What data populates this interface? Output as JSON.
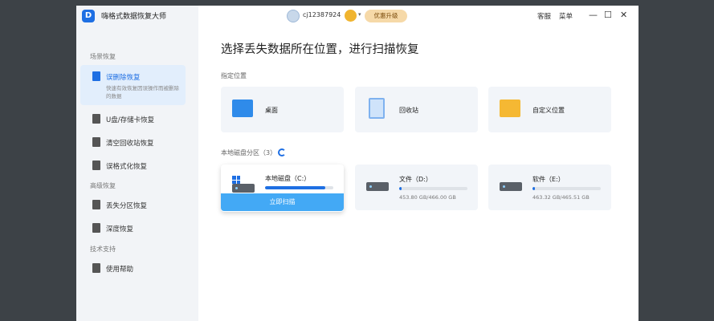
{
  "app": {
    "logo_letter": "D",
    "title": "嗨格式数据恢复大师"
  },
  "header": {
    "username": "cj12387924",
    "upgrade_label": "优惠升级",
    "service_label": "客服",
    "menu_label": "菜单",
    "minimize": "—",
    "maximize": "☐",
    "close": "✕"
  },
  "sidebar": {
    "groups": [
      {
        "label": "场景恢复"
      },
      {
        "label": "高级恢复"
      },
      {
        "label": "技术支持"
      }
    ],
    "active_item": {
      "label": "误删除恢复",
      "description": "快速有效恢复因误操作而被删除的数据"
    },
    "items": [
      {
        "label": "U盘/存储卡恢复"
      },
      {
        "label": "清空回收站恢复"
      },
      {
        "label": "误格式化恢复"
      },
      {
        "label": "丢失分区恢复"
      },
      {
        "label": "深度恢复"
      },
      {
        "label": "使用帮助"
      }
    ]
  },
  "main": {
    "title": "选择丢失数据所在位置，进行扫描恢复",
    "locations_label": "指定位置",
    "locations": [
      {
        "label": "桌面"
      },
      {
        "label": "回收站"
      },
      {
        "label": "自定义位置"
      }
    ],
    "disks_label": "本地磁盘分区（3）",
    "disks": [
      {
        "name": "本地磁盘（C:）",
        "used_fraction": 0.88,
        "size": ""
      },
      {
        "name": "文件（D:）",
        "used_fraction": 0.03,
        "size": "453.80 GB/466.00 GB"
      },
      {
        "name": "软件（E:）",
        "used_fraction": 0.03,
        "size": "463.32 GB/465.51 GB"
      }
    ],
    "scan_button": "立即扫描"
  },
  "colors": {
    "accent": "#1e6fe3",
    "scan_button": "#43a9f5",
    "upgrade_bg": "#f6d9a8"
  }
}
